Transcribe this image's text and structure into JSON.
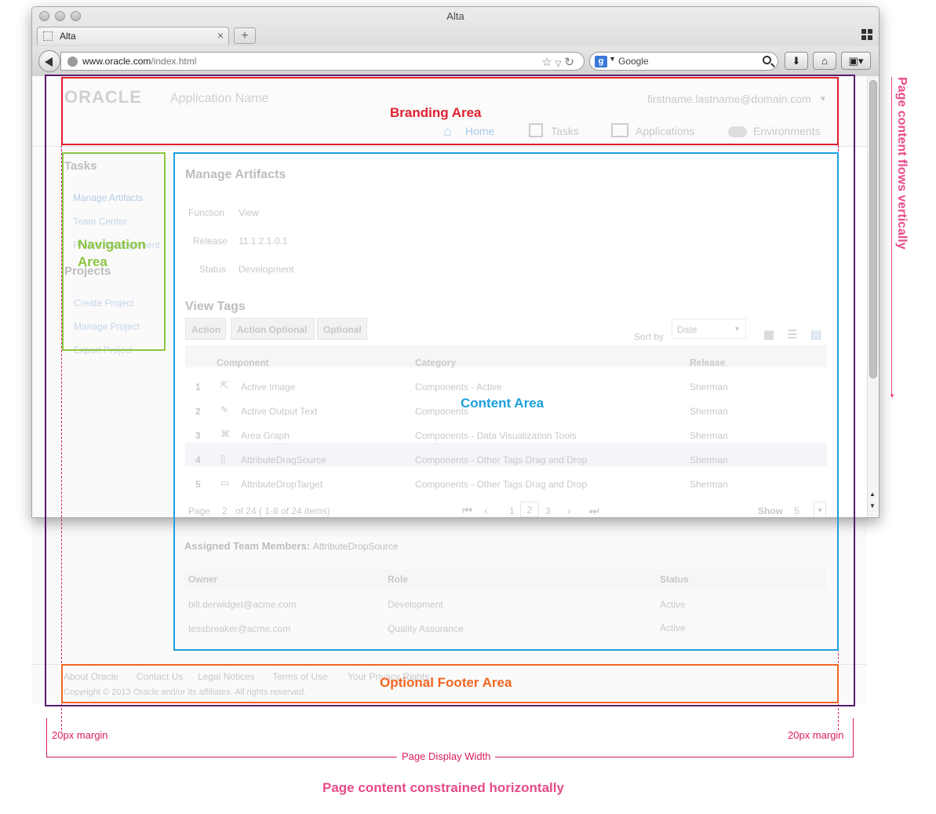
{
  "window": {
    "title": "Alta",
    "tab_label": "Alta",
    "new_tab": "+",
    "url_domain": "www.oracle.com",
    "url_path": "/index.html",
    "search_placeholder": "Google",
    "search_engine_badge": "g"
  },
  "app": {
    "logo": "ORACLE",
    "app_name": "Application Name",
    "user": "firstname.lastname@domain.com",
    "nav_tabs": [
      "Home",
      "Tasks",
      "Applications",
      "Environments"
    ]
  },
  "sidebar": {
    "tasks_heading": "Tasks",
    "task_items": [
      "Manage Artifacts",
      "Team Center",
      "Project Management"
    ],
    "projects_heading": "Projects",
    "project_items": [
      "Create Project",
      "Manage Project",
      "Export Project"
    ]
  },
  "content": {
    "title": "Manage Artifacts",
    "fields": [
      {
        "label": "Function",
        "value": "View"
      },
      {
        "label": "Release",
        "value": "11.1.2.1.0.1"
      },
      {
        "label": "Status",
        "value": "Development"
      }
    ],
    "tags_title": "View Tags",
    "toolbar_buttons": [
      "Action",
      "Action Optional",
      "Optional"
    ],
    "sort_label": "Sort by",
    "sort_value": "Date",
    "table_headers": [
      "Component",
      "Category",
      "Release"
    ],
    "rows": [
      {
        "n": "1",
        "component": "Active Image",
        "category": "Components - Active",
        "release": "Sherman"
      },
      {
        "n": "2",
        "component": "Active Output Text",
        "category": "Components",
        "release": "Sherman"
      },
      {
        "n": "3",
        "component": "Area Graph",
        "category": "Components - Data Visualization Tools",
        "release": "Sherman"
      },
      {
        "n": "4",
        "component": "AttributeDragSource",
        "category": "Components - Other Tags Drag and Drop",
        "release": "Sherman"
      },
      {
        "n": "5",
        "component": "AttributeDropTarget",
        "category": "Components - Other Tags Drag and Drop",
        "release": "Sherman"
      }
    ],
    "pager": {
      "page_label": "Page",
      "page_value": "2",
      "page_info": "of 24 ( 1-8 of 24 items)",
      "pages": [
        "1",
        "2",
        "3"
      ],
      "show_label": "Show",
      "show_value": "5"
    },
    "assigned_title": "Assigned Team Members:",
    "assigned_sub": "AttributeDropSource",
    "team_headers": [
      "Owner",
      "Role",
      "Status"
    ],
    "team_rows": [
      {
        "owner": "bill.derwidget@acme.com",
        "role": "Development",
        "status": "Active"
      },
      {
        "owner": "tessbreaker@acme.com",
        "role": "Quality Assurance",
        "status": "Active"
      }
    ]
  },
  "footer": {
    "links": [
      "About Oracle",
      "Contact Us",
      "Legal Notices",
      "Terms of Use",
      "Your Privacy Rights"
    ],
    "copyright": "Copyright © 2013 Oracle and/or its affiliates. All rights reserved."
  },
  "annotations": {
    "branding": "Branding Area",
    "navigation": "Navigation Area",
    "content": "Content Area",
    "footer": "Optional Footer Area",
    "margin_left": "20px margin",
    "margin_right": "20px margin",
    "display_width": "Page Display Width",
    "constrained": "Page content constrained horizontally",
    "vertical_flow": "Page content flows vertically"
  },
  "colors": {
    "branding": "#e0202e",
    "navigation": "#8cc63f",
    "content": "#1aa0dc",
    "footer": "#f26522",
    "page_frame": "#5a1a6e",
    "annotation_pink": "#e84a8a"
  }
}
